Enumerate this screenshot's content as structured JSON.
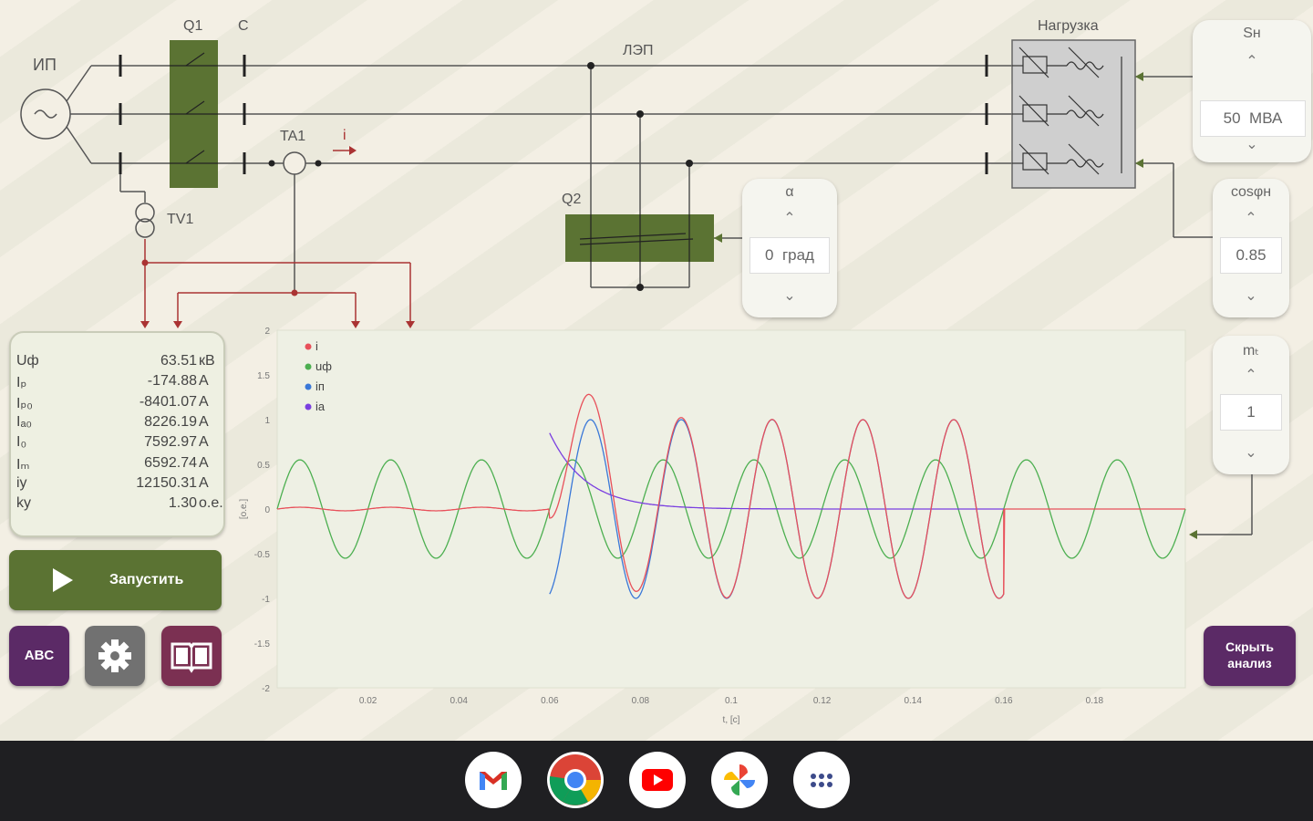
{
  "schematic": {
    "source_label": "ИП",
    "q1_label": "Q1",
    "c_label": "C",
    "line_label": "ЛЭП",
    "load_label": "Нагрузка",
    "ta1_label": "TA1",
    "current_label": "i",
    "tv1_label": "TV1",
    "q2_label": "Q2"
  },
  "params": {
    "sn": {
      "title": "Sн",
      "value": "50",
      "unit": "МВА"
    },
    "cosphi": {
      "title": "cosφн",
      "value": "0.85"
    },
    "alpha": {
      "title": "α",
      "value": "0",
      "unit": "град"
    },
    "m": {
      "title": "mₜ",
      "value": "1"
    }
  },
  "readings": [
    {
      "name": "Uф",
      "value": "63.51",
      "unit": "кВ"
    },
    {
      "name": "Iₚ",
      "value": "-174.88",
      "unit": "А"
    },
    {
      "name": "Iₚ₀",
      "value": "-8401.07",
      "unit": "А"
    },
    {
      "name": "Iₐ₀",
      "value": "8226.19",
      "unit": "А"
    },
    {
      "name": "I₀",
      "value": "7592.97",
      "unit": "А"
    },
    {
      "name": "Iₘ",
      "value": "6592.74",
      "unit": "А"
    },
    {
      "name": "iу",
      "value": "12150.31",
      "unit": "А"
    },
    {
      "name": "kу",
      "value": "1.30",
      "unit": "о.е."
    }
  ],
  "buttons": {
    "run": "Запустить",
    "abc": "ABC",
    "hide_line1": "Скрыть",
    "hide_line2": "анализ"
  },
  "chart_data": {
    "type": "line",
    "xlabel": "t, [c]",
    "ylabel": "[о.е.]",
    "xlim": [
      0,
      0.2
    ],
    "ylim": [
      -2,
      2
    ],
    "x_ticks": [
      "0.02",
      "0.04",
      "0.06",
      "0.08",
      "0.1",
      "0.12",
      "0.14",
      "0.16",
      "0.18"
    ],
    "y_ticks": [
      "2",
      "1.5",
      "1",
      "0.5",
      "0",
      "-0.5",
      "-1",
      "-1.5",
      "-2"
    ],
    "grid": false,
    "legend_position": "top-left",
    "series": [
      {
        "name": "i",
        "color": "#e8505a",
        "description": "load current ~0 until t=0.06, fault transient peaking ~1.3 at t~0.068, trough ~-0.93 at t~0.078, peak ~1.0 at t~0.088, tracks ip, returns to 0 at t=0.16"
      },
      {
        "name": "uф",
        "color": "#4caf50",
        "description": "phase voltage sinusoid amplitude 0.55, period 0.02, peaks at t=0.005+0.02k"
      },
      {
        "name": "iп",
        "color": "#3a78d8",
        "description": "periodic component amplitude 1.0, from t=0.06 to t=0.16, peaks at t=0.089+0.02k"
      },
      {
        "name": "iа",
        "color": "#7a3fe0",
        "description": "aperiodic component decaying from 0.85 at t=0.06, time constant ~0.008"
      }
    ],
    "colors": {
      "i": "#e8505a",
      "u": "#4caf50",
      "ip": "#3a78d8",
      "ia": "#7a3fe0"
    }
  },
  "taskbar": {
    "apps": [
      "gmail-icon",
      "chrome-icon",
      "youtube-icon",
      "photos-icon",
      "app-launcher-icon"
    ]
  }
}
